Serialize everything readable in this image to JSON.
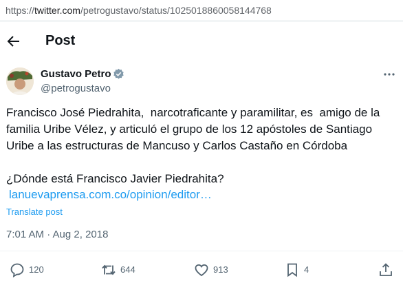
{
  "browser": {
    "url_protocol": "https://",
    "url_host": "twitter.com",
    "url_path": "/petrogustavo/status/1025018860058144768"
  },
  "header": {
    "title": "Post"
  },
  "author": {
    "name": "Gustavo Petro",
    "handle": "@petrogustavo"
  },
  "tweet": {
    "lines": [
      "Francisco José Piedrahita,  narcotraficante y paramilitar, es  amigo de la",
      "familia Uribe Vélez, y articuló el grupo de los 12 apóstoles de Santiago",
      "Uribe a las estructuras de Mancuso y Carlos Castaño en Córdoba",
      "",
      "¿Dónde está Francisco Javier Piedrahita?"
    ],
    "link": "lanuevaprensa.com.co/opinion/editor…",
    "translate": "Translate post",
    "timestamp": "7:01 AM · Aug 2, 2018"
  },
  "actions": {
    "reply_count": "120",
    "repost_count": "644",
    "like_count": "913",
    "bookmark_count": "4"
  },
  "colors": {
    "accent": "#1d9bf0",
    "text": "#0f1419",
    "muted": "#536471"
  },
  "icons": [
    "arrow-left-icon",
    "verified-badge-icon",
    "more-icon",
    "reply-icon",
    "repost-icon",
    "like-icon",
    "bookmark-icon",
    "share-icon"
  ]
}
